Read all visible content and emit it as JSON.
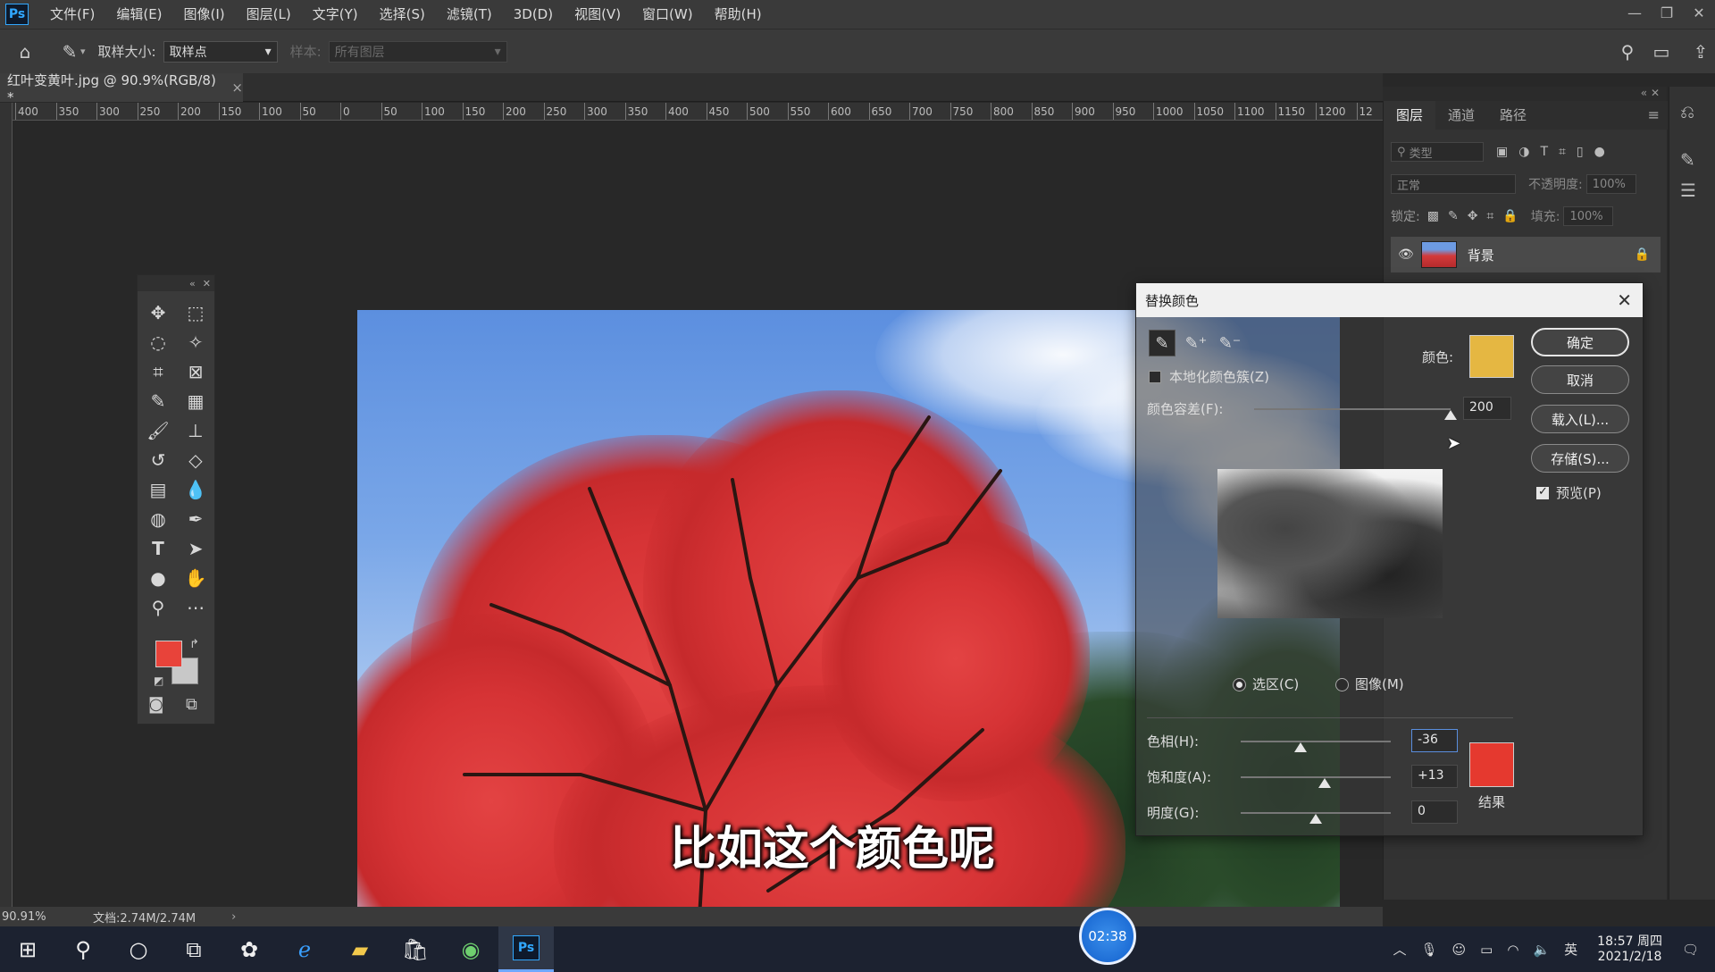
{
  "menu": {
    "logo": "Ps",
    "items": [
      "文件(F)",
      "编辑(E)",
      "图像(I)",
      "图层(L)",
      "文字(Y)",
      "选择(S)",
      "滤镜(T)",
      "3D(D)",
      "视图(V)",
      "窗口(W)",
      "帮助(H)"
    ]
  },
  "options": {
    "sample_size_label": "取样大小:",
    "sample_size_value": "取样点",
    "sample_label": "样本:",
    "sample_value": "所有图层"
  },
  "document": {
    "tab_title": "红叶变黄叶.jpg @ 90.9%(RGB/8) *",
    "close": "×"
  },
  "ruler": {
    "ticks": [
      "400",
      "350",
      "300",
      "250",
      "200",
      "150",
      "100",
      "50",
      "0",
      "50",
      "100",
      "150",
      "200",
      "250",
      "300",
      "350",
      "400",
      "450",
      "500",
      "550",
      "600",
      "650",
      "700",
      "750",
      "800",
      "850",
      "900",
      "950",
      "1000",
      "1050",
      "1100",
      "1150",
      "1200",
      "12"
    ]
  },
  "layers_panel": {
    "tabs": [
      "图层",
      "通道",
      "路径"
    ],
    "filter_placeholder": "类型",
    "blend_mode": "正常",
    "opacity_label": "不透明度:",
    "opacity_value": "100%",
    "lock_label": "锁定:",
    "fill_label": "填充:",
    "fill_value": "100%",
    "layer_name": "背景"
  },
  "dialog": {
    "title": "替换颜色",
    "color_label": "颜色:",
    "localized_label": "本地化颜色簇(Z)",
    "fuzziness_label": "颜色容差(F):",
    "fuzziness_value": "200",
    "fuzziness_fraction": 1.0,
    "selection_radio": "选区(C)",
    "image_radio": "图像(M)",
    "hue_label": "色相(H):",
    "hue_value": "-36",
    "saturation_label": "饱和度(A):",
    "saturation_value": "+13",
    "lightness_label": "明度(G):",
    "lightness_value": "0",
    "result_label": "结果",
    "ok": "确定",
    "cancel": "取消",
    "load": "载入(L)...",
    "save": "存储(S)...",
    "preview": "预览(P)",
    "selected_color": "#e5b742",
    "result_color": "#e5392f"
  },
  "tools": {
    "foreground_color": "#e8433a",
    "background_color": "#c8c8c8"
  },
  "subtitle": "比如这个颜色呢",
  "status": {
    "zoom": "90.91%",
    "doc_info": "文档:2.74M/2.74M",
    "arrow": "›"
  },
  "taskbar": {
    "timer": "02:38",
    "ime": "英",
    "time": "18:57 周四",
    "date": "2021/2/18",
    "ps_label": "Ps"
  }
}
